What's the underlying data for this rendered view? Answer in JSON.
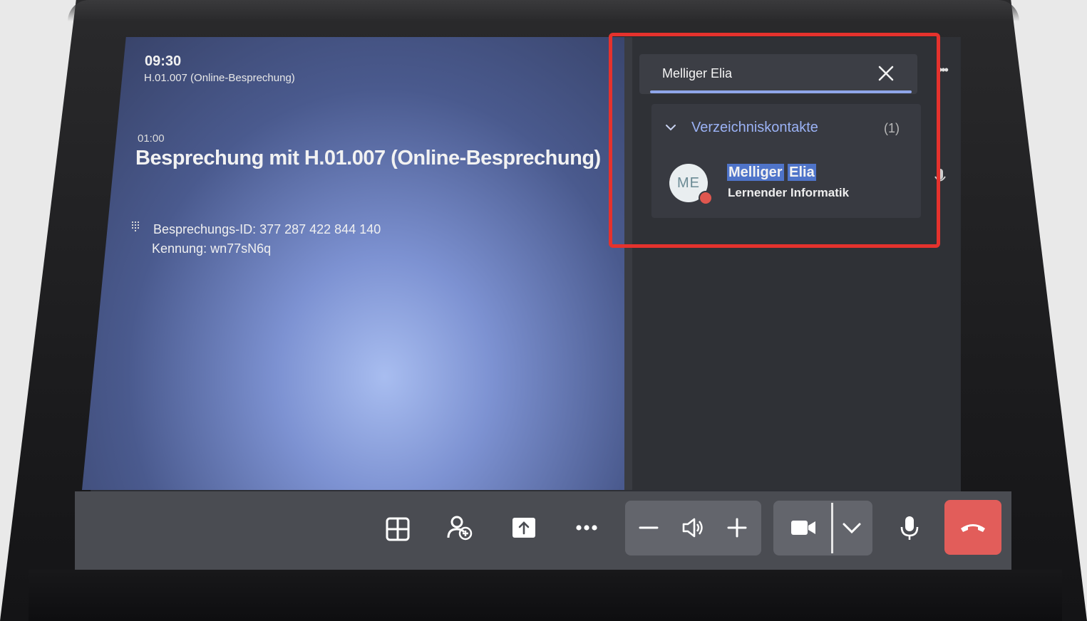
{
  "meeting": {
    "clock": "09:30",
    "room": "H.01.007 (Online-Besprechung)",
    "duration": "01:00",
    "title": "Besprechung mit H.01.007 (Online-Besprechung)",
    "meeting_id": "Besprechungs-ID:  377 287 422 844 140",
    "passcode": "Kennung: wn77sN6q"
  },
  "people_panel": {
    "search_value": "Melliger Elia",
    "group_label": "Verzeichniskontakte",
    "group_count": "(1)",
    "contact": {
      "initials": "ME",
      "name_first": "Melliger",
      "name_last": "Elia",
      "role": "Lernender Informatik",
      "presence": "busy"
    }
  },
  "controls": {
    "items": [
      "layout-icon",
      "participants-icon",
      "share-icon",
      "more-icon",
      "volume-down-icon",
      "speaker-icon",
      "volume-up-icon",
      "camera-icon",
      "chevron-down-icon",
      "microphone-icon",
      "hang-up-icon"
    ]
  },
  "colors": {
    "accent": "#8fa6ea",
    "highlight": "#4f74c9",
    "hangup": "#e25d5a",
    "presence_busy": "#e0574f",
    "annotation_frame": "#e5322d"
  }
}
